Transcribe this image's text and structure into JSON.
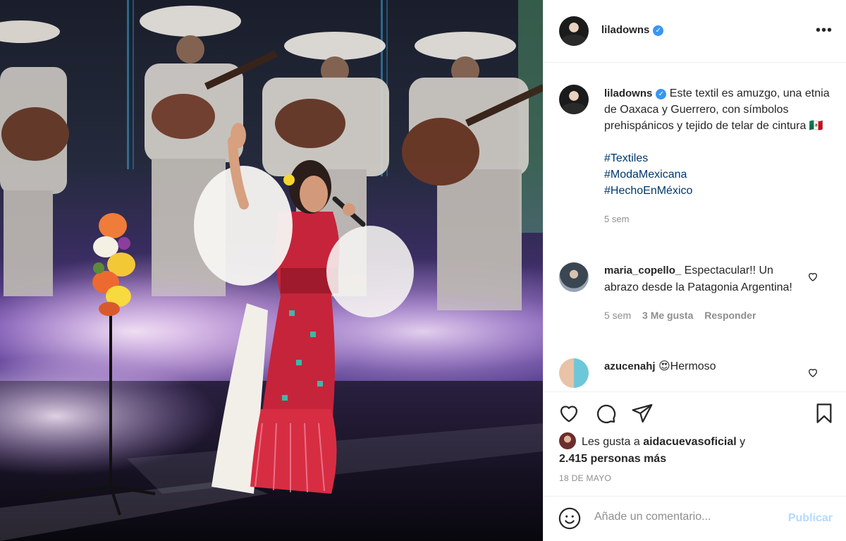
{
  "post": {
    "author": {
      "username": "liladowns",
      "verified": true,
      "avatar": "profile-photo"
    },
    "more_icon": "more-horizontal-icon",
    "caption": {
      "text": "Este textil es amuzgo, una etnia de Oaxaca y Guerrero, con símbolos prehispánicos y tejido de telar de cintura 🇲🇽",
      "hashtags": [
        "#Textiles",
        "#ModaMexicana",
        "#HechoEnMéxico"
      ],
      "time": "5 sem"
    },
    "comments": [
      {
        "username": "maria_copello_",
        "text": "Espectacular!! Un abrazo desde la Patagonia Argentina!",
        "time": "5 sem",
        "likes": "3 Me gusta",
        "reply": "Responder"
      },
      {
        "username": "azucenahj",
        "text": "😍Hermoso"
      }
    ],
    "actions": [
      "heart-icon",
      "comment-icon",
      "share-icon",
      "bookmark-icon"
    ],
    "likes": {
      "prefix": "Les gusta a",
      "user": "aidacuevasoficial",
      "conj": "y",
      "others": "2.415 personas más"
    },
    "date": "18 DE MAYO",
    "add_comment": {
      "placeholder": "Añade un comentario...",
      "publish": "Publicar"
    }
  },
  "colors": {
    "link": "#00376b",
    "verified": "#3897f0",
    "publish_disabled": "#b3dbff",
    "muted": "#8e8e8e"
  }
}
